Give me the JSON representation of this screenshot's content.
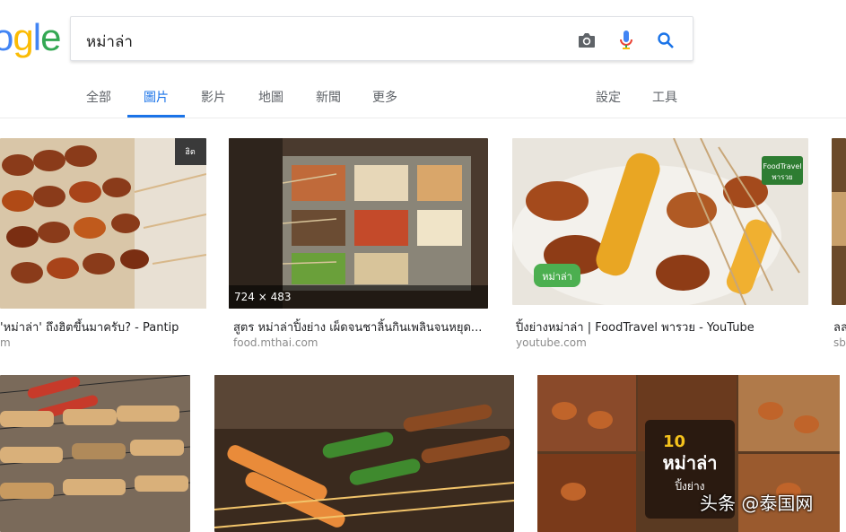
{
  "search": {
    "query": "หม่าล่า"
  },
  "tabs": [
    {
      "label": "全部"
    },
    {
      "label": "圖片"
    },
    {
      "label": "影片"
    },
    {
      "label": "地圖"
    },
    {
      "label": "新聞"
    },
    {
      "label": "更多"
    }
  ],
  "tools": {
    "settings": "設定",
    "tools": "工具"
  },
  "results": [
    {
      "title": "'หม่าล่า' ถึงฮิตขึ้นมาครับ? - Pantip",
      "source": "m"
    },
    {
      "title": "สูตร หม่าล่าปิ้งย่าง เผ็ดจนชาลิ้นกินเพลินจนหยุด...",
      "source": "food.mthai.com",
      "dims": "724 × 483"
    },
    {
      "title": "ปิ้งย่างหม่าล่า | FoodTravel พารวย - YouTube",
      "source": "youtube.com"
    },
    {
      "title": "ลล",
      "source": "sb"
    }
  ],
  "overlays": {
    "foodtravel_badge": "FoodTravel",
    "foodtravel_sub": "พารวย",
    "mala_tag": "หม่าล่า",
    "poster_num": "10",
    "poster_title": "หม่าล่า",
    "poster_sub": "ปิ้งย่าง",
    "pantip_tag": "ฮิต"
  },
  "watermark": "头条 @泰国网",
  "colors": {
    "accent": "#1a73e8",
    "title": "#202124",
    "source": "#8b8b8b"
  }
}
